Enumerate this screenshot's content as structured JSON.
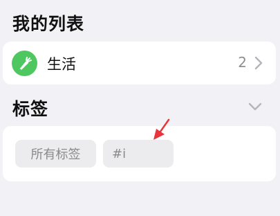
{
  "sections": {
    "lists_title": "我的列表",
    "tags_title": "标签"
  },
  "lists": [
    {
      "label": "生活",
      "count": "2",
      "icon": "carrot-icon",
      "icon_color": "#4fc760"
    }
  ],
  "tags": [
    {
      "label": "所有标签"
    },
    {
      "label": "#i"
    }
  ],
  "colors": {
    "background": "#f2f1f6",
    "card": "#ffffff",
    "chip": "#ececef",
    "annotation_arrow": "#e8343a"
  }
}
